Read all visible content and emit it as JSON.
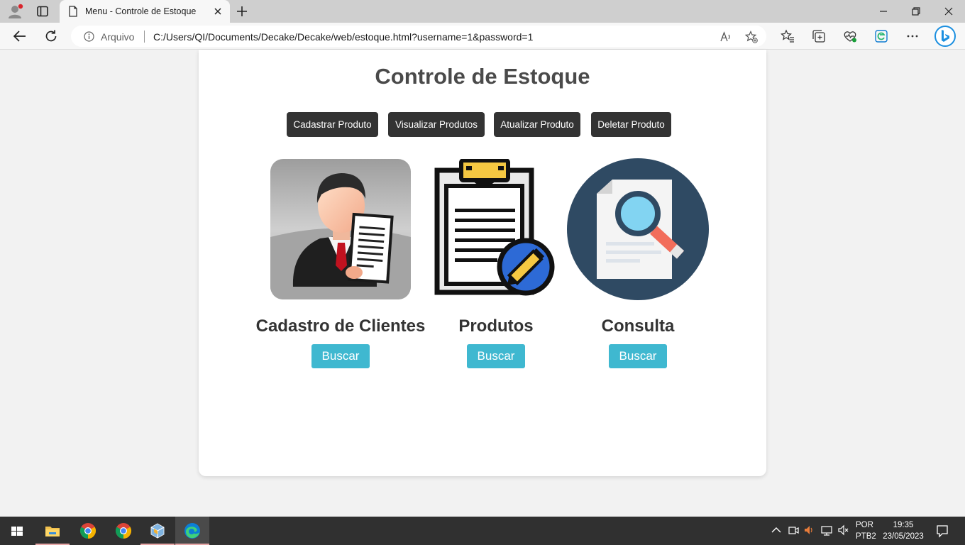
{
  "browser": {
    "tab_title": "Menu - Controle de Estoque",
    "address_prefix": "Arquivo",
    "url": "C:/Users/QI/Documents/Decake/Decake/web/estoque.html?username=1&password=1"
  },
  "page": {
    "title": "Controle de Estoque",
    "menu": {
      "cadastrar": "Cadastrar Produto",
      "visualizar": "Visualizar Produtos",
      "atualizar": "Atualizar Produto",
      "deletar": "Deletar Produto"
    },
    "sections": {
      "clientes": {
        "title": "Cadastro de Clientes",
        "button": "Buscar"
      },
      "produtos": {
        "title": "Produtos",
        "button": "Buscar"
      },
      "consulta": {
        "title": "Consulta",
        "button": "Buscar"
      }
    }
  },
  "taskbar": {
    "lang_line1": "POR",
    "lang_line2": "PTB2",
    "time": "19:35",
    "date": "23/05/2023"
  },
  "colors": {
    "menu_button_bg": "#333333",
    "buscar_button_bg": "#3fb8d0",
    "title_text": "#4a4a4a",
    "page_bg": "#f2f2f2"
  },
  "icons": {
    "tabbar": [
      "profile-icon",
      "tab-actions-icon",
      "page-icon",
      "close-icon",
      "plus-icon",
      "minimize-icon",
      "restore-icon",
      "close-window-icon"
    ],
    "toolbar": [
      "back-arrow-icon",
      "reload-icon",
      "info-icon",
      "read-aloud-icon",
      "add-favorite-icon",
      "favorites-icon",
      "collections-icon",
      "performance-icon",
      "edge-bar-icon",
      "more-icon",
      "bing-icon"
    ],
    "taskbar": [
      "windows-start-icon",
      "file-explorer-icon",
      "chrome-icon",
      "chrome-icon",
      "virtualbox-icon",
      "edge-icon",
      "chevron-up-icon",
      "meet-now-icon",
      "volume-icon",
      "network-icon",
      "mute-icon",
      "notification-icon"
    ]
  }
}
